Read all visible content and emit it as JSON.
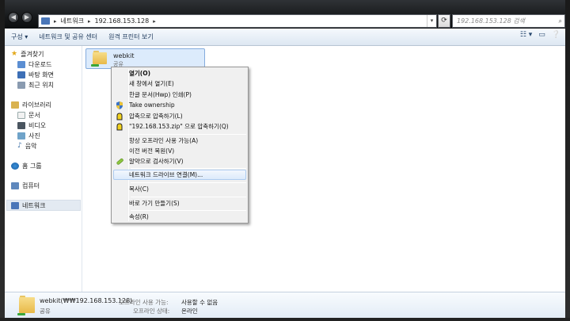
{
  "address": {
    "crumbs": [
      "네트워크",
      "192.168.153.128"
    ]
  },
  "search": {
    "placeholder": "192.168.153.128 검색"
  },
  "toolbar": {
    "organize": "구성 ▾",
    "network_sharing": "네트워크 및 공유 센터",
    "remote_printers": "원격 프린터 보기"
  },
  "nav": {
    "favorites": "즐겨찾기",
    "downloads": "다운로드",
    "desktop": "바탕 화면",
    "recent": "최근 위치",
    "libraries": "라이브러리",
    "documents": "문서",
    "videos": "비디오",
    "pictures": "사진",
    "music": "음악",
    "homegroup": "홈 그룹",
    "computer": "컴퓨터",
    "network": "네트워크"
  },
  "item": {
    "name": "webkit",
    "subtitle": "공유"
  },
  "context_menu": {
    "open": "열기(O)",
    "open_new": "새 창에서 열기(E)",
    "hwp_print": "한글 문서(Hwp) 인쇄(P)",
    "take_ownership": "Take ownership",
    "compress": "압축으로 압축하기(L)",
    "compress_zip": "\"192.168.153.zip\" 으로 압축하기(Q)",
    "offline": "항상 오프라인 사용 가능(A)",
    "restore": "이전 버전 복원(V)",
    "scan": "알약으로 검사하기(V)",
    "map_drive": "네트워크 드라이브 연결(M)...",
    "copy": "복사(C)",
    "shortcut": "바로 가기 만들기(S)",
    "properties": "속성(R)"
  },
  "details": {
    "name": "webkit(₩₩192.168.153.128)",
    "share": "공유",
    "offline_label": "오프라인 사용 가능:",
    "offline_value": "사용할 수 없음",
    "status_label": "오프라인 상태:",
    "status_value": "온라인"
  }
}
